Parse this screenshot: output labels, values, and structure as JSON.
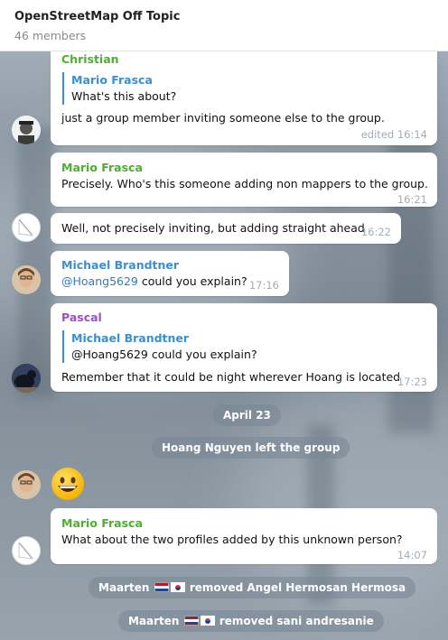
{
  "header": {
    "title": "OpenStreetMap Off Topic",
    "members": "46 members"
  },
  "messages": [
    {
      "sender": "Christian",
      "sender_color": "#4caf30",
      "reply": {
        "name": "Mario Frasca",
        "text": "What's this about?"
      },
      "text": "just a group member inviting someone else to the group.",
      "time": "edited 16:14"
    },
    {
      "sender": "Mario Frasca",
      "sender_color": "#4caf30",
      "text": "Precisely. Who's this someone adding non mappers to the group.",
      "time": "16:21"
    },
    {
      "text": "Well, not precisely inviting, but adding straight ahead",
      "time": "16:22"
    },
    {
      "sender": "Michael Brandtner",
      "sender_color": "#3a8fd0",
      "mention": "@Hoang5629",
      "text": " could you explain?",
      "time": "17:16"
    },
    {
      "sender": "Pascal",
      "sender_color": "#9b4fd0",
      "reply": {
        "name": "Michael Brandtner",
        "text": "@Hoang5629 could you explain?"
      },
      "text": "Remember that it could be night wherever Hoang is located",
      "time": "17:23"
    },
    {
      "emoji": "grinning-face"
    },
    {
      "sender": "Mario Frasca",
      "sender_color": "#4caf30",
      "text": "What about the two profiles added by this unknown person?",
      "time": "14:07"
    }
  ],
  "service": {
    "date": "April 23",
    "left": "Hoang Nguyen left the group",
    "removed1": {
      "actor": "Maarten",
      "text": "removed Angel Hermosan Hermosa"
    },
    "removed2": {
      "actor": "Maarten",
      "text": "removed sani andresanie"
    }
  }
}
